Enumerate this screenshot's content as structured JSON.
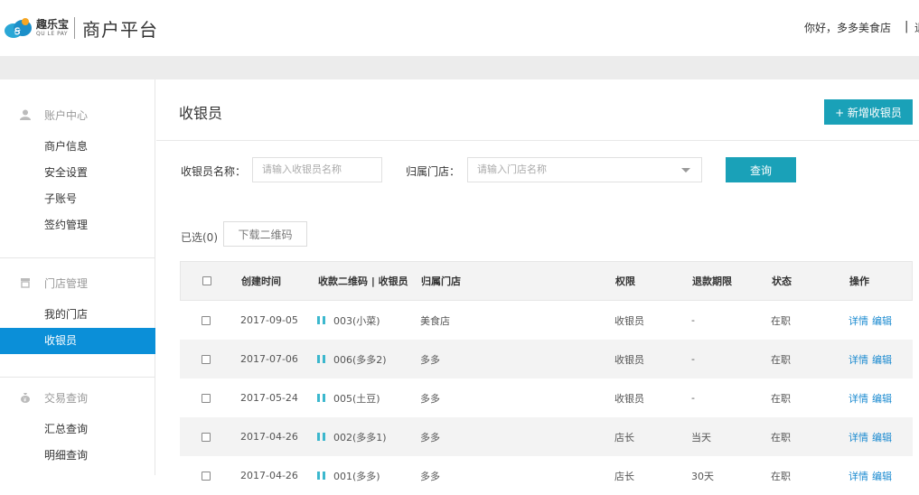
{
  "header": {
    "logo_cn": "趣乐宝",
    "logo_en": "QU LE PAY",
    "platform_title": "商户平台",
    "greeting": "你好，多多美食店",
    "separator": "|",
    "cut_text": "退"
  },
  "sidebar": {
    "groups": [
      {
        "title": "账户中心",
        "icon": "user-icon",
        "items": [
          "商户信息",
          "安全设置",
          "子账号",
          "签约管理"
        ]
      },
      {
        "title": "门店管理",
        "icon": "store-icon",
        "items": [
          "我的门店",
          "收银员"
        ]
      },
      {
        "title": "交易查询",
        "icon": "money-bag-icon",
        "items": [
          "汇总查询",
          "明细查询"
        ]
      }
    ],
    "active_item": "收银员"
  },
  "main": {
    "title": "收银员",
    "add_button": "+ 新增收银员",
    "filters": {
      "name_label": "收银员名称：",
      "name_placeholder": "请输入收银员名称",
      "store_label": "归属门店：",
      "store_placeholder": "请输入门店名称",
      "query_button": "查询"
    },
    "selected_count": "已选(0)",
    "download_button": "下载二维码",
    "table": {
      "headers": [
        "创建时间",
        "收款二维码 | 收银员",
        "归属门店",
        "权限",
        "退款期限",
        "状态",
        "操作"
      ],
      "rows": [
        {
          "date": "2017-09-05",
          "cashier": "003(小菜)",
          "store": "美食店",
          "role": "收银员",
          "refund": "-",
          "status": "在职",
          "ops": [
            "详情",
            "编辑"
          ]
        },
        {
          "date": "2017-07-06",
          "cashier": "006(多多2)",
          "store": "多多",
          "role": "收银员",
          "refund": "-",
          "status": "在职",
          "ops": [
            "详情",
            "编辑"
          ]
        },
        {
          "date": "2017-05-24",
          "cashier": "005(土豆)",
          "store": "多多",
          "role": "收银员",
          "refund": "-",
          "status": "在职",
          "ops": [
            "详情",
            "编辑"
          ]
        },
        {
          "date": "2017-04-26",
          "cashier": "002(多多1)",
          "store": "多多",
          "role": "店长",
          "refund": "当天",
          "status": "在职",
          "ops": [
            "详情",
            "编辑"
          ]
        },
        {
          "date": "2017-04-26",
          "cashier": "001(多多)",
          "store": "多多",
          "role": "店长",
          "refund": "30天",
          "status": "在职",
          "ops": [
            "详情",
            "编辑"
          ]
        }
      ]
    }
  },
  "colors": {
    "accent": "#1aa1b8",
    "active_nav": "#0b8fd8",
    "link": "#1a8ad0"
  }
}
